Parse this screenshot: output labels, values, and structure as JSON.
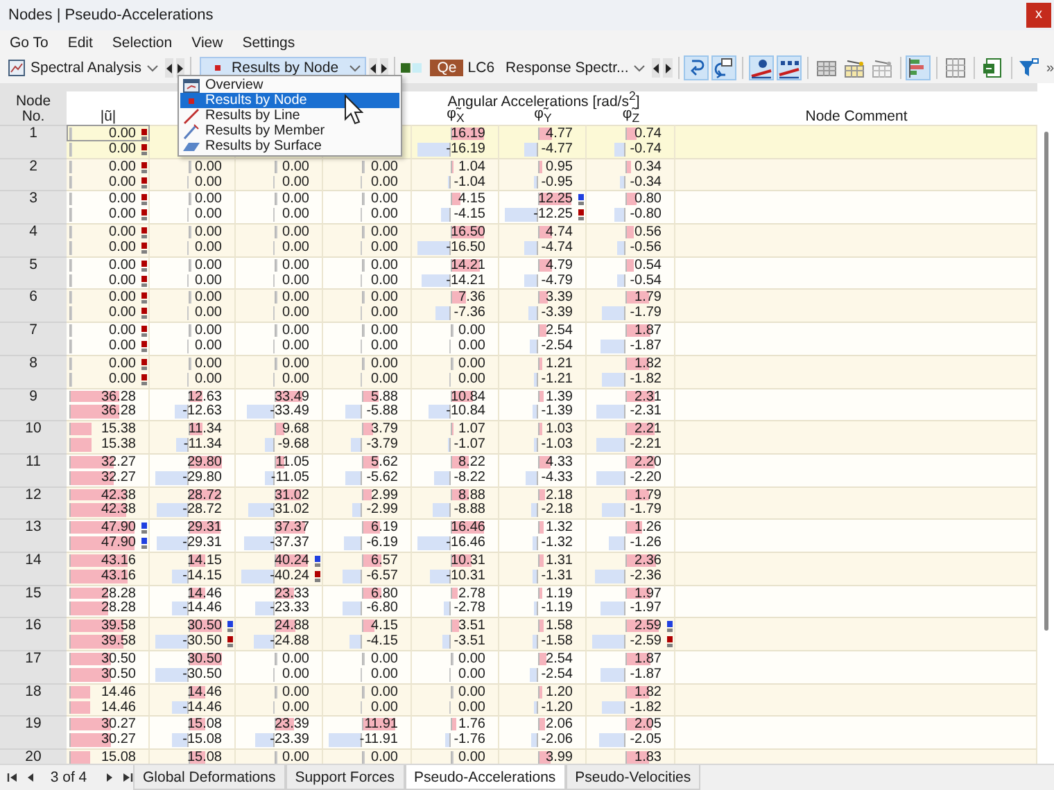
{
  "window": {
    "title": "Nodes | Pseudo-Accelerations",
    "close": "x"
  },
  "menu": [
    "Go To",
    "Edit",
    "Selection",
    "View",
    "Settings"
  ],
  "toolbar": {
    "analysis": "Spectral Analysis",
    "result_type": "Results by Node",
    "load_case_tag": "Qe",
    "load_case": "LC6",
    "load_case_name": "Response Spectr...",
    "groups": [
      [
        {
          "kind": "rotate-left",
          "on": true
        },
        {
          "kind": "rotate-right",
          "on": true
        }
      ],
      [
        {
          "kind": "values-graph",
          "on": true
        },
        {
          "kind": "labels-graph",
          "on": true
        }
      ],
      [
        {
          "kind": "table-gray",
          "on": false
        },
        {
          "kind": "table-yellow",
          "on": false
        },
        {
          "kind": "table-remove",
          "on": false
        }
      ],
      [
        {
          "kind": "bar-chart",
          "on": true
        }
      ],
      [
        {
          "kind": "grid",
          "on": false
        }
      ],
      [
        {
          "kind": "export",
          "on": false
        }
      ],
      [
        {
          "kind": "filter",
          "on": false
        }
      ]
    ],
    "overflow": "»"
  },
  "dropdown": {
    "items": [
      {
        "label": "Overview",
        "kind": "overview",
        "selected": false
      },
      {
        "label": "Results by Node",
        "kind": "node",
        "selected": true
      },
      {
        "label": "Results by Line",
        "kind": "line",
        "selected": false
      },
      {
        "label": "Results by Member",
        "kind": "member",
        "selected": false
      },
      {
        "label": "Results by Surface",
        "kind": "surface",
        "selected": false
      }
    ]
  },
  "table": {
    "columns": [
      "Node No.",
      "|ũ|",
      "φ̃$_{X}$",
      "φ̃$_{Y}$",
      "φ̃$_{Z}$",
      "Node Comment"
    ],
    "group_header": "Angular Accelerations [rad/s$^{2}$]",
    "nodes": [
      {
        "no": "1",
        "selected": true,
        "rows": [
          {
            "kind": "max",
            "cells": [
              {
                "text": "0.00",
                "level": 0,
                "color": "#b00000"
              },
              null,
              null,
              null,
              {
                "text": "16.19",
                "level": 0.98
              },
              {
                "text": "4.77",
                "level": 0.39
              },
              {
                "text": "0.74",
                "level": 0.29
              }
            ]
          },
          {
            "kind": "min",
            "cells": [
              {
                "text": "0.00",
                "level": 0,
                "color": "#b00000"
              },
              null,
              null,
              null,
              {
                "text": "-16.19",
                "level": 0.98
              },
              {
                "text": "-4.77",
                "level": 0.39
              },
              {
                "text": "-0.74",
                "level": 0.29
              }
            ]
          }
        ]
      },
      {
        "no": "2",
        "selected": false,
        "rows": [
          {
            "kind": "max",
            "cells": [
              {
                "text": "0.00",
                "level": 0,
                "color": "#b00000"
              },
              {
                "text": "0.00",
                "level": 0
              },
              {
                "text": "0.00",
                "level": 0
              },
              {
                "text": "0.00",
                "level": 0
              },
              {
                "text": "1.04",
                "level": 0.06
              },
              {
                "text": "0.95",
                "level": 0.08
              },
              {
                "text": "0.34",
                "level": 0.13
              }
            ]
          },
          {
            "kind": "min",
            "cells": [
              {
                "text": "0.00",
                "level": 0,
                "color": "#b00000"
              },
              {
                "text": "0.00",
                "level": 0
              },
              {
                "text": "0.00",
                "level": 0
              },
              {
                "text": "0.00",
                "level": 0
              },
              {
                "text": "-1.04",
                "level": 0.06
              },
              {
                "text": "-0.95",
                "level": 0.08
              },
              {
                "text": "-0.34",
                "level": 0.13
              }
            ]
          }
        ]
      },
      {
        "no": "3",
        "selected": false,
        "rows": [
          {
            "kind": "max",
            "cells": [
              {
                "text": "0.00",
                "level": 0,
                "color": "#b00000"
              },
              {
                "text": "0.00",
                "level": 0
              },
              {
                "text": "0.00",
                "level": 0
              },
              {
                "text": "0.00",
                "level": 0
              },
              {
                "text": "4.15",
                "level": 0.25
              },
              {
                "text": "12.25",
                "level": 1,
                "color": "#2040e0"
              },
              {
                "text": "0.80",
                "level": 0.31
              }
            ]
          },
          {
            "kind": "min",
            "cells": [
              {
                "text": "0.00",
                "level": 0,
                "color": "#b00000"
              },
              {
                "text": "0.00",
                "level": 0
              },
              {
                "text": "0.00",
                "level": 0
              },
              {
                "text": "0.00",
                "level": 0
              },
              {
                "text": "-4.15",
                "level": 0.25
              },
              {
                "text": "-12.25",
                "level": 1,
                "color": "#b00000"
              },
              {
                "text": "-0.80",
                "level": 0.31
              }
            ]
          }
        ]
      },
      {
        "no": "4",
        "selected": false,
        "rows": [
          {
            "kind": "max",
            "cells": [
              {
                "text": "0.00",
                "level": 0,
                "color": "#b00000"
              },
              {
                "text": "0.00",
                "level": 0
              },
              {
                "text": "0.00",
                "level": 0
              },
              {
                "text": "0.00",
                "level": 0
              },
              {
                "text": "16.50",
                "level": 1
              },
              {
                "text": "4.74",
                "level": 0.39
              },
              {
                "text": "0.56",
                "level": 0.22
              }
            ]
          },
          {
            "kind": "min",
            "cells": [
              {
                "text": "0.00",
                "level": 0,
                "color": "#b00000"
              },
              {
                "text": "0.00",
                "level": 0
              },
              {
                "text": "0.00",
                "level": 0
              },
              {
                "text": "0.00",
                "level": 0
              },
              {
                "text": "-16.50",
                "level": 1
              },
              {
                "text": "-4.74",
                "level": 0.39
              },
              {
                "text": "-0.56",
                "level": 0.22
              }
            ]
          }
        ]
      },
      {
        "no": "5",
        "selected": false,
        "rows": [
          {
            "kind": "max",
            "cells": [
              {
                "text": "0.00",
                "level": 0,
                "color": "#b00000"
              },
              {
                "text": "0.00",
                "level": 0
              },
              {
                "text": "0.00",
                "level": 0
              },
              {
                "text": "0.00",
                "level": 0
              },
              {
                "text": "14.21",
                "level": 0.86
              },
              {
                "text": "4.79",
                "level": 0.39
              },
              {
                "text": "0.54",
                "level": 0.21
              }
            ]
          },
          {
            "kind": "min",
            "cells": [
              {
                "text": "0.00",
                "level": 0,
                "color": "#b00000"
              },
              {
                "text": "0.00",
                "level": 0
              },
              {
                "text": "0.00",
                "level": 0
              },
              {
                "text": "0.00",
                "level": 0
              },
              {
                "text": "-14.21",
                "level": 0.86
              },
              {
                "text": "-4.79",
                "level": 0.39
              },
              {
                "text": "-0.54",
                "level": 0.21
              }
            ]
          }
        ]
      },
      {
        "no": "6",
        "selected": false,
        "rows": [
          {
            "kind": "max",
            "cells": [
              {
                "text": "0.00",
                "level": 0,
                "color": "#b00000"
              },
              {
                "text": "0.00",
                "level": 0
              },
              {
                "text": "0.00",
                "level": 0
              },
              {
                "text": "0.00",
                "level": 0
              },
              {
                "text": "7.36",
                "level": 0.45
              },
              {
                "text": "3.39",
                "level": 0.28
              },
              {
                "text": "1.79",
                "level": 0.69
              }
            ]
          },
          {
            "kind": "min",
            "cells": [
              {
                "text": "0.00",
                "level": 0,
                "color": "#b00000"
              },
              {
                "text": "0.00",
                "level": 0
              },
              {
                "text": "0.00",
                "level": 0
              },
              {
                "text": "0.00",
                "level": 0
              },
              {
                "text": "-7.36",
                "level": 0.45
              },
              {
                "text": "-3.39",
                "level": 0.28
              },
              {
                "text": "-1.79",
                "level": 0.69
              }
            ]
          }
        ]
      },
      {
        "no": "7",
        "selected": false,
        "rows": [
          {
            "kind": "max",
            "cells": [
              {
                "text": "0.00",
                "level": 0,
                "color": "#b00000"
              },
              {
                "text": "0.00",
                "level": 0
              },
              {
                "text": "0.00",
                "level": 0
              },
              {
                "text": "0.00",
                "level": 0
              },
              {
                "text": "0.00",
                "level": 0
              },
              {
                "text": "2.54",
                "level": 0.21
              },
              {
                "text": "1.87",
                "level": 0.72
              }
            ]
          },
          {
            "kind": "min",
            "cells": [
              {
                "text": "0.00",
                "level": 0,
                "color": "#b00000"
              },
              {
                "text": "0.00",
                "level": 0
              },
              {
                "text": "0.00",
                "level": 0
              },
              {
                "text": "0.00",
                "level": 0
              },
              {
                "text": "0.00",
                "level": 0
              },
              {
                "text": "-2.54",
                "level": 0.21
              },
              {
                "text": "-1.87",
                "level": 0.72
              }
            ]
          }
        ]
      },
      {
        "no": "8",
        "selected": false,
        "rows": [
          {
            "kind": "max",
            "cells": [
              {
                "text": "0.00",
                "level": 0,
                "color": "#b00000"
              },
              {
                "text": "0.00",
                "level": 0
              },
              {
                "text": "0.00",
                "level": 0
              },
              {
                "text": "0.00",
                "level": 0
              },
              {
                "text": "0.00",
                "level": 0
              },
              {
                "text": "1.21",
                "level": 0.1
              },
              {
                "text": "1.82",
                "level": 0.7
              }
            ]
          },
          {
            "kind": "min",
            "cells": [
              {
                "text": "0.00",
                "level": 0,
                "color": "#b00000"
              },
              {
                "text": "0.00",
                "level": 0
              },
              {
                "text": "0.00",
                "level": 0
              },
              {
                "text": "0.00",
                "level": 0
              },
              {
                "text": "0.00",
                "level": 0
              },
              {
                "text": "-1.21",
                "level": 0.1
              },
              {
                "text": "-1.82",
                "level": 0.7
              }
            ]
          }
        ]
      },
      {
        "no": "9",
        "selected": false,
        "rows": [
          {
            "kind": "max",
            "cells": [
              {
                "text": "36.28",
                "level": 0.76
              },
              {
                "text": "12.63",
                "level": 0.41
              },
              {
                "text": "33.49",
                "level": 0.83
              },
              {
                "text": "5.88",
                "level": 0.49
              },
              {
                "text": "10.84",
                "level": 0.66
              },
              {
                "text": "1.39",
                "level": 0.11
              },
              {
                "text": "2.31",
                "level": 0.89
              }
            ]
          },
          {
            "kind": "min",
            "cells": [
              {
                "text": "36.28",
                "level": 0.76
              },
              {
                "text": "-12.63",
                "level": 0.41
              },
              {
                "text": "-33.49",
                "level": 0.83
              },
              {
                "text": "-5.88",
                "level": 0.49
              },
              {
                "text": "-10.84",
                "level": 0.66
              },
              {
                "text": "-1.39",
                "level": 0.11
              },
              {
                "text": "-2.31",
                "level": 0.89
              }
            ]
          }
        ]
      },
      {
        "no": "10",
        "selected": false,
        "rows": [
          {
            "kind": "max",
            "cells": [
              {
                "text": "15.38",
                "level": 0.32
              },
              {
                "text": "11.34",
                "level": 0.37
              },
              {
                "text": "9.68",
                "level": 0.24
              },
              {
                "text": "3.79",
                "level": 0.32
              },
              {
                "text": "1.07",
                "level": 0.06
              },
              {
                "text": "1.03",
                "level": 0.08
              },
              {
                "text": "2.21",
                "level": 0.85
              }
            ]
          },
          {
            "kind": "min",
            "cells": [
              {
                "text": "15.38",
                "level": 0.32
              },
              {
                "text": "-11.34",
                "level": 0.37
              },
              {
                "text": "-9.68",
                "level": 0.24
              },
              {
                "text": "-3.79",
                "level": 0.32
              },
              {
                "text": "-1.07",
                "level": 0.06
              },
              {
                "text": "-1.03",
                "level": 0.08
              },
              {
                "text": "-2.21",
                "level": 0.85
              }
            ]
          }
        ]
      },
      {
        "no": "11",
        "selected": false,
        "rows": [
          {
            "kind": "max",
            "cells": [
              {
                "text": "32.27",
                "level": 0.67
              },
              {
                "text": "29.80",
                "level": 0.98
              },
              {
                "text": "11.05",
                "level": 0.27
              },
              {
                "text": "5.62",
                "level": 0.47
              },
              {
                "text": "8.22",
                "level": 0.5
              },
              {
                "text": "4.33",
                "level": 0.35
              },
              {
                "text": "2.20",
                "level": 0.85
              }
            ]
          },
          {
            "kind": "min",
            "cells": [
              {
                "text": "32.27",
                "level": 0.67
              },
              {
                "text": "-29.80",
                "level": 0.98
              },
              {
                "text": "-11.05",
                "level": 0.27
              },
              {
                "text": "-5.62",
                "level": 0.47
              },
              {
                "text": "-8.22",
                "level": 0.5
              },
              {
                "text": "-4.33",
                "level": 0.35
              },
              {
                "text": "-2.20",
                "level": 0.85
              }
            ]
          }
        ]
      },
      {
        "no": "12",
        "selected": false,
        "rows": [
          {
            "kind": "max",
            "cells": [
              {
                "text": "42.38",
                "level": 0.88
              },
              {
                "text": "28.72",
                "level": 0.94
              },
              {
                "text": "31.02",
                "level": 0.77
              },
              {
                "text": "2.99",
                "level": 0.25
              },
              {
                "text": "8.88",
                "level": 0.54
              },
              {
                "text": "2.18",
                "level": 0.18
              },
              {
                "text": "1.79",
                "level": 0.69
              }
            ]
          },
          {
            "kind": "min",
            "cells": [
              {
                "text": "42.38",
                "level": 0.88
              },
              {
                "text": "-28.72",
                "level": 0.94
              },
              {
                "text": "-31.02",
                "level": 0.77
              },
              {
                "text": "-2.99",
                "level": 0.25
              },
              {
                "text": "-8.88",
                "level": 0.54
              },
              {
                "text": "-2.18",
                "level": 0.18
              },
              {
                "text": "-1.79",
                "level": 0.69
              }
            ]
          }
        ]
      },
      {
        "no": "13",
        "selected": false,
        "rows": [
          {
            "kind": "max",
            "cells": [
              {
                "text": "47.90",
                "level": 1,
                "color": "#2040e0"
              },
              {
                "text": "29.31",
                "level": 0.96
              },
              {
                "text": "37.37",
                "level": 0.93
              },
              {
                "text": "6.19",
                "level": 0.52
              },
              {
                "text": "16.46",
                "level": 1
              },
              {
                "text": "1.32",
                "level": 0.11
              },
              {
                "text": "1.26",
                "level": 0.49
              }
            ]
          },
          {
            "kind": "min",
            "cells": [
              {
                "text": "47.90",
                "level": 1,
                "color": "#2040e0"
              },
              {
                "text": "-29.31",
                "level": 0.96
              },
              {
                "text": "-37.37",
                "level": 0.93
              },
              {
                "text": "-6.19",
                "level": 0.52
              },
              {
                "text": "-16.46",
                "level": 1
              },
              {
                "text": "-1.32",
                "level": 0.11
              },
              {
                "text": "-1.26",
                "level": 0.49
              }
            ]
          }
        ]
      },
      {
        "no": "14",
        "selected": false,
        "rows": [
          {
            "kind": "max",
            "cells": [
              {
                "text": "43.16",
                "level": 0.9
              },
              {
                "text": "14.15",
                "level": 0.46
              },
              {
                "text": "40.24",
                "level": 1,
                "color": "#2040e0"
              },
              {
                "text": "6.57",
                "level": 0.55
              },
              {
                "text": "10.31",
                "level": 0.62
              },
              {
                "text": "1.31",
                "level": 0.11
              },
              {
                "text": "2.36",
                "level": 0.91
              }
            ]
          },
          {
            "kind": "min",
            "cells": [
              {
                "text": "43.16",
                "level": 0.9
              },
              {
                "text": "-14.15",
                "level": 0.46
              },
              {
                "text": "-40.24",
                "level": 1,
                "color": "#b00000"
              },
              {
                "text": "-6.57",
                "level": 0.55
              },
              {
                "text": "-10.31",
                "level": 0.62
              },
              {
                "text": "-1.31",
                "level": 0.11
              },
              {
                "text": "-2.36",
                "level": 0.91
              }
            ]
          }
        ]
      },
      {
        "no": "15",
        "selected": false,
        "rows": [
          {
            "kind": "max",
            "cells": [
              {
                "text": "28.28",
                "level": 0.59
              },
              {
                "text": "14.46",
                "level": 0.47
              },
              {
                "text": "23.33",
                "level": 0.58
              },
              {
                "text": "6.80",
                "level": 0.57
              },
              {
                "text": "2.78",
                "level": 0.17
              },
              {
                "text": "1.19",
                "level": 0.1
              },
              {
                "text": "1.97",
                "level": 0.76
              }
            ]
          },
          {
            "kind": "min",
            "cells": [
              {
                "text": "28.28",
                "level": 0.59
              },
              {
                "text": "-14.46",
                "level": 0.47
              },
              {
                "text": "-23.33",
                "level": 0.58
              },
              {
                "text": "-6.80",
                "level": 0.57
              },
              {
                "text": "-2.78",
                "level": 0.17
              },
              {
                "text": "-1.19",
                "level": 0.1
              },
              {
                "text": "-1.97",
                "level": 0.76
              }
            ]
          }
        ]
      },
      {
        "no": "16",
        "selected": false,
        "rows": [
          {
            "kind": "max",
            "cells": [
              {
                "text": "39.58",
                "level": 0.83
              },
              {
                "text": "30.50",
                "level": 1,
                "color": "#2040e0"
              },
              {
                "text": "24.88",
                "level": 0.62
              },
              {
                "text": "4.15",
                "level": 0.35
              },
              {
                "text": "3.51",
                "level": 0.21
              },
              {
                "text": "1.58",
                "level": 0.13
              },
              {
                "text": "2.59",
                "level": 1,
                "color": "#2040e0"
              }
            ]
          },
          {
            "kind": "min",
            "cells": [
              {
                "text": "39.58",
                "level": 0.83
              },
              {
                "text": "-30.50",
                "level": 1,
                "color": "#b00000"
              },
              {
                "text": "-24.88",
                "level": 0.62
              },
              {
                "text": "-4.15",
                "level": 0.35
              },
              {
                "text": "-3.51",
                "level": 0.21
              },
              {
                "text": "-1.58",
                "level": 0.13
              },
              {
                "text": "-2.59",
                "level": 1,
                "color": "#b00000"
              }
            ]
          }
        ]
      },
      {
        "no": "17",
        "selected": false,
        "rows": [
          {
            "kind": "max",
            "cells": [
              {
                "text": "30.50",
                "level": 0.64
              },
              {
                "text": "30.50",
                "level": 1
              },
              {
                "text": "0.00",
                "level": 0
              },
              {
                "text": "0.00",
                "level": 0
              },
              {
                "text": "0.00",
                "level": 0
              },
              {
                "text": "2.54",
                "level": 0.21
              },
              {
                "text": "1.87",
                "level": 0.72
              }
            ]
          },
          {
            "kind": "min",
            "cells": [
              {
                "text": "30.50",
                "level": 0.64
              },
              {
                "text": "-30.50",
                "level": 1
              },
              {
                "text": "0.00",
                "level": 0
              },
              {
                "text": "0.00",
                "level": 0
              },
              {
                "text": "0.00",
                "level": 0
              },
              {
                "text": "-2.54",
                "level": 0.21
              },
              {
                "text": "-1.87",
                "level": 0.72
              }
            ]
          }
        ]
      },
      {
        "no": "18",
        "selected": false,
        "rows": [
          {
            "kind": "max",
            "cells": [
              {
                "text": "14.46",
                "level": 0.3
              },
              {
                "text": "14.46",
                "level": 0.47
              },
              {
                "text": "0.00",
                "level": 0
              },
              {
                "text": "0.00",
                "level": 0
              },
              {
                "text": "0.00",
                "level": 0
              },
              {
                "text": "1.20",
                "level": 0.1
              },
              {
                "text": "1.82",
                "level": 0.7
              }
            ]
          },
          {
            "kind": "min",
            "cells": [
              {
                "text": "14.46",
                "level": 0.3
              },
              {
                "text": "-14.46",
                "level": 0.47
              },
              {
                "text": "0.00",
                "level": 0
              },
              {
                "text": "0.00",
                "level": 0
              },
              {
                "text": "0.00",
                "level": 0
              },
              {
                "text": "-1.20",
                "level": 0.1
              },
              {
                "text": "-1.82",
                "level": 0.7
              }
            ]
          }
        ]
      },
      {
        "no": "19",
        "selected": false,
        "rows": [
          {
            "kind": "max",
            "cells": [
              {
                "text": "30.27",
                "level": 0.63
              },
              {
                "text": "15.08",
                "level": 0.49
              },
              {
                "text": "23.39",
                "level": 0.58
              },
              {
                "text": "11.91",
                "level": 1
              },
              {
                "text": "1.76",
                "level": 0.11
              },
              {
                "text": "2.06",
                "level": 0.17
              },
              {
                "text": "2.05",
                "level": 0.79
              }
            ]
          },
          {
            "kind": "min",
            "cells": [
              {
                "text": "30.27",
                "level": 0.63
              },
              {
                "text": "-15.08",
                "level": 0.49
              },
              {
                "text": "-23.39",
                "level": 0.58
              },
              {
                "text": "-11.91",
                "level": 1
              },
              {
                "text": "-1.76",
                "level": 0.11
              },
              {
                "text": "-2.06",
                "level": 0.17
              },
              {
                "text": "-2.05",
                "level": 0.79
              }
            ]
          }
        ]
      },
      {
        "no": "20",
        "selected": false,
        "rows": [
          {
            "kind": "max",
            "cells": [
              {
                "text": "15.08",
                "level": 0.31
              },
              {
                "text": "15.08",
                "level": 0.49
              },
              {
                "text": "0.00",
                "level": 0
              },
              {
                "text": "0.00",
                "level": 0
              },
              {
                "text": "0.00",
                "level": 0
              },
              {
                "text": "3.99",
                "level": 0.33
              },
              {
                "text": "1.83",
                "level": 0.71
              }
            ]
          }
        ]
      }
    ]
  },
  "pager": {
    "position": "3 of 4"
  },
  "tabs": [
    {
      "label": "Global Deformations",
      "selected": false
    },
    {
      "label": "Support Forces",
      "selected": false
    },
    {
      "label": "Pseudo-Accelerations",
      "selected": true
    },
    {
      "label": "Pseudo-Velocities",
      "selected": false
    }
  ]
}
